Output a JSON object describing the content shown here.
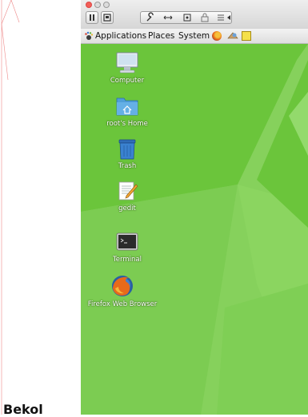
{
  "vm_toolbar": {
    "icons": [
      "pause-icon",
      "snapshot-icon",
      "settings-icon",
      "resize-icon",
      "disk-icon",
      "lock-icon",
      "network-icon",
      "arrow-icon"
    ]
  },
  "panel": {
    "applications": "Applications",
    "places": "Places",
    "system": "System"
  },
  "desktop": {
    "icons": [
      {
        "label": "Computer",
        "icon": "computer-icon"
      },
      {
        "label": "root's Home",
        "icon": "home-folder-icon"
      },
      {
        "label": "Trash",
        "icon": "trash-icon"
      },
      {
        "label": "gedit",
        "icon": "gedit-icon"
      },
      {
        "label": "Terminal",
        "icon": "terminal-icon"
      },
      {
        "label": "Firefox Web Browser",
        "icon": "firefox-icon"
      }
    ]
  },
  "bottom_text": "Bekol",
  "colors": {
    "desktop_green": "#6bc53b",
    "desktop_light_green": "#8fd465"
  }
}
